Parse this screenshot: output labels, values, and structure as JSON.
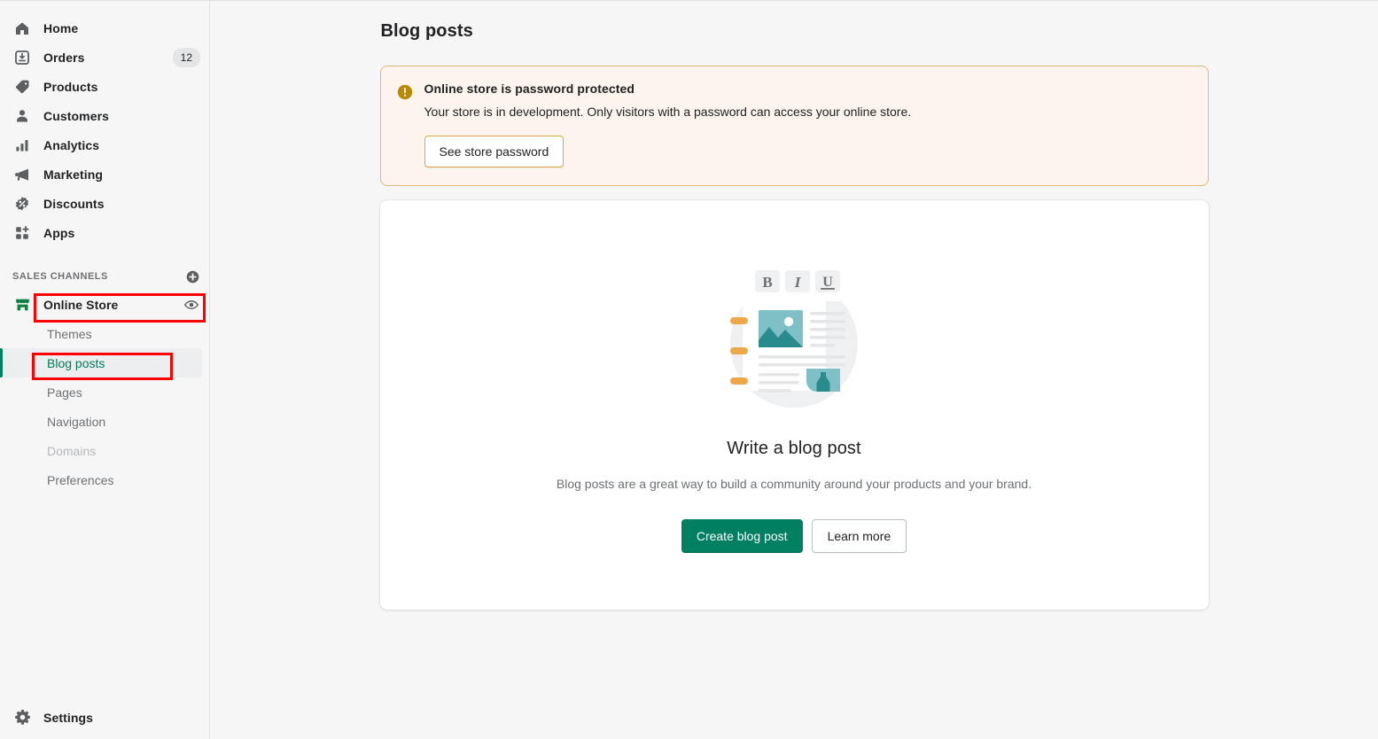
{
  "sidebar": {
    "nav_items": [
      {
        "label": "Home",
        "icon": "home-icon",
        "badge": null
      },
      {
        "label": "Orders",
        "icon": "orders-icon",
        "badge": "12"
      },
      {
        "label": "Products",
        "icon": "products-icon",
        "badge": null
      },
      {
        "label": "Customers",
        "icon": "customers-icon",
        "badge": null
      },
      {
        "label": "Analytics",
        "icon": "analytics-icon",
        "badge": null
      },
      {
        "label": "Marketing",
        "icon": "marketing-icon",
        "badge": null
      },
      {
        "label": "Discounts",
        "icon": "discounts-icon",
        "badge": null
      },
      {
        "label": "Apps",
        "icon": "apps-icon",
        "badge": null
      }
    ],
    "sales_channels": {
      "section_title": "SALES CHANNELS",
      "add_icon": "plus-circle-icon",
      "channel": {
        "label": "Online Store",
        "icon": "storefront-icon",
        "view_icon": "eye-icon"
      },
      "sub_items": [
        {
          "label": "Themes",
          "state": "normal"
        },
        {
          "label": "Blog posts",
          "state": "active"
        },
        {
          "label": "Pages",
          "state": "normal"
        },
        {
          "label": "Navigation",
          "state": "normal"
        },
        {
          "label": "Domains",
          "state": "disabled"
        },
        {
          "label": "Preferences",
          "state": "normal"
        }
      ]
    },
    "settings": {
      "label": "Settings",
      "icon": "gear-icon"
    }
  },
  "main": {
    "page_title": "Blog posts",
    "banner": {
      "icon": "alert-circle-icon",
      "title": "Online store is password protected",
      "text": "Your store is in development. Only visitors with a password can access your online store.",
      "button_label": "See store password"
    },
    "empty_state": {
      "illustration": "blog-post-editor-illustration",
      "title": "Write a blog post",
      "description": "Blog posts are a great way to build a community around your products and your brand.",
      "primary_button": "Create blog post",
      "secondary_button": "Learn more",
      "toolbar_glyphs": [
        "B",
        "I",
        "U"
      ]
    }
  },
  "annotations": [
    {
      "target": "Online Store",
      "color": "#ff0000"
    },
    {
      "target": "Blog posts",
      "color": "#ff0000"
    }
  ],
  "colors": {
    "brand_green": "#008060",
    "active_green": "#007b5c",
    "warning_amber": "#b98900",
    "banner_bg": "#fdf5ed",
    "banner_border": "#e1b878",
    "annotation_red": "#ff0000",
    "page_bg": "#f6f6f7"
  }
}
